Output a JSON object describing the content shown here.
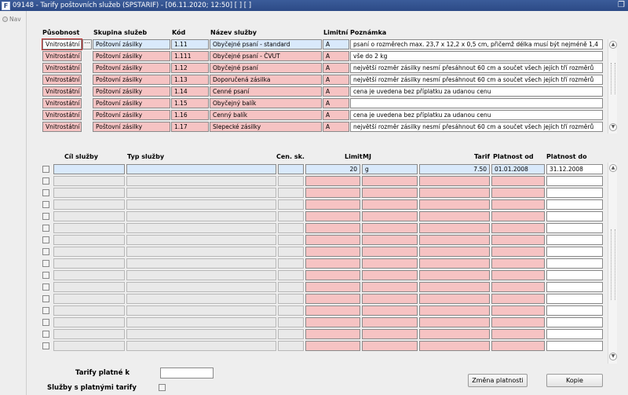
{
  "window": {
    "title": "09148 - Tarify poštovních služeb (SPSTARIF) - [06.11.2020; 12:50]  [ ]  [ ]"
  },
  "nav": {
    "label": "Nav"
  },
  "master": {
    "headers": {
      "pusobnost": "Působnost",
      "skupina": "Skupina služeb",
      "kod": "Kód",
      "nazev": "Název služby",
      "limitni": "Limitní",
      "poznamka": "Poznámka"
    },
    "rows": [
      {
        "pusobnost": "Vnitrostátní",
        "skupina": "Poštovní zásilky",
        "kod": "1.11",
        "nazev": "Obyčejné psaní - standard",
        "limitni": "A",
        "poznamka": "psaní o rozměrech max. 23,7 x 12,2 x 0,5 cm, přičemž délka musí být nejméně 1,4"
      },
      {
        "pusobnost": "Vnitrostátní",
        "skupina": "Poštovní zásilky",
        "kod": "1.111",
        "nazev": "Obyčejné psaní - ČVUT",
        "limitni": "A",
        "poznamka": "vše do 2 kg"
      },
      {
        "pusobnost": "Vnitrostátní",
        "skupina": "Poštovní zásilky",
        "kod": "1.12",
        "nazev": "Obyčejné psaní",
        "limitni": "A",
        "poznamka": "největší rozměr zásilky nesmí přesáhnout 60 cm a součet všech jejích tří rozměrů"
      },
      {
        "pusobnost": "Vnitrostátní",
        "skupina": "Poštovní zásilky",
        "kod": "1.13",
        "nazev": "Doporučená zásilka",
        "limitni": "A",
        "poznamka": "největší rozměr zásilky nesmí přesáhnout 60 cm a součet všech jejích tří rozměrů"
      },
      {
        "pusobnost": "Vnitrostátní",
        "skupina": "Poštovní zásilky",
        "kod": "1.14",
        "nazev": "Cenné psaní",
        "limitni": "A",
        "poznamka": "cena je uvedena bez příplatku za udanou cenu"
      },
      {
        "pusobnost": "Vnitrostátní",
        "skupina": "Poštovní zásilky",
        "kod": "1.15",
        "nazev": "Obyčejný balík",
        "limitni": "A",
        "poznamka": ""
      },
      {
        "pusobnost": "Vnitrostátní",
        "skupina": "Poštovní zásilky",
        "kod": "1.16",
        "nazev": "Cenný balík",
        "limitni": "A",
        "poznamka": "cena je uvedena bez příplatku za udanou cenu"
      },
      {
        "pusobnost": "Vnitrostátní",
        "skupina": "Poštovní zásilky",
        "kod": "1.17",
        "nazev": "Slepecké zásilky",
        "limitni": "A",
        "poznamka": "největší rozměr zásilky nesmí přesáhnout 60 cm a součet všech jejích tří rozměrů"
      }
    ]
  },
  "detail": {
    "headers": {
      "cil": "Cíl služby",
      "typ": "Typ služby",
      "censk": "Cen. sk.",
      "limit": "Limit",
      "mj": "MJ",
      "tarif": "Tarif",
      "od": "Platnost od",
      "do": "Platnost do"
    },
    "first_row": {
      "cil": "",
      "typ": "",
      "censk": "",
      "limit": "20",
      "mj": "g",
      "tarif": "7.50",
      "od": "01.01.2008",
      "do": "31.12.2008"
    }
  },
  "footer": {
    "tarify_label": "Tarify platné k",
    "tarify_value": "",
    "sluzby_label": "Služby s platnými tarify",
    "zmena_button": "Změna platnosti",
    "kopie_button": "Kopie"
  }
}
